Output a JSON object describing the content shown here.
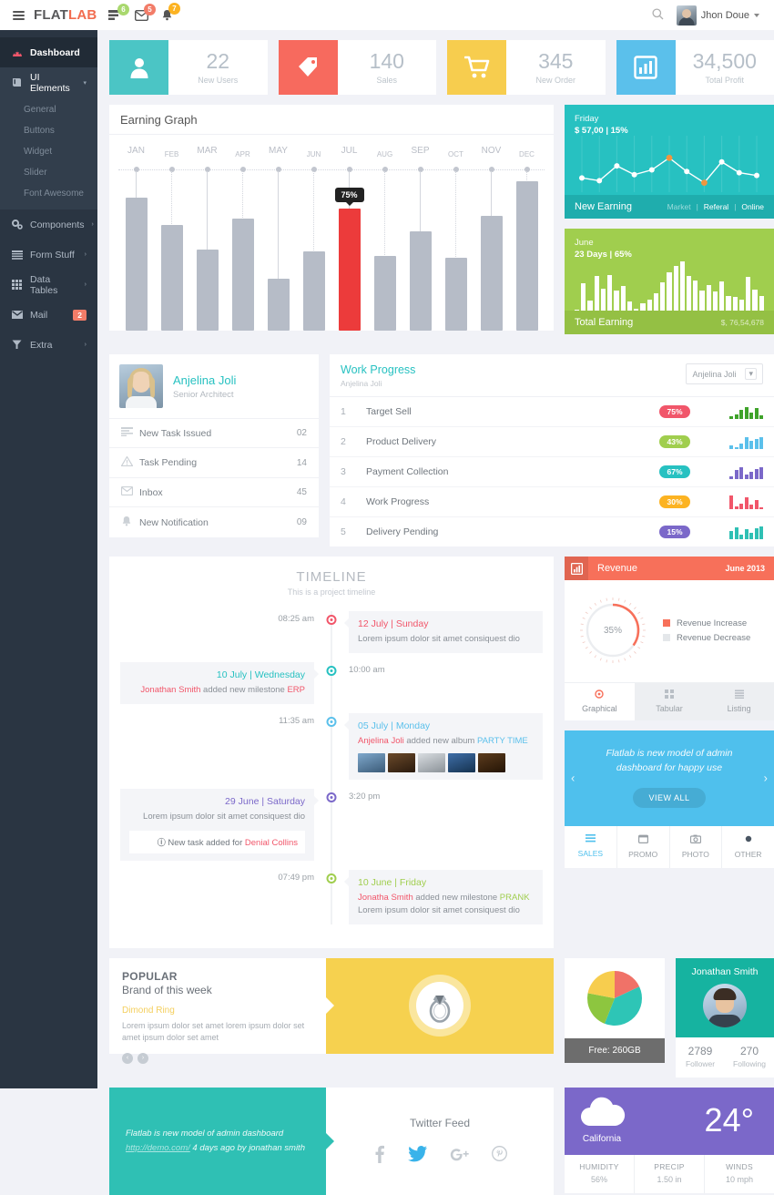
{
  "header": {
    "logo_flat": "FLAT",
    "logo_lab": "LAB",
    "icons": [
      {
        "name": "tasks-icon",
        "badge": "6",
        "color": "green"
      },
      {
        "name": "envelope-icon",
        "badge": "5",
        "color": "red"
      },
      {
        "name": "bell-icon",
        "badge": "7",
        "color": "yellow"
      }
    ],
    "search_label": "search-icon",
    "user_name": "Jhon Doue"
  },
  "sidebar": {
    "items": [
      {
        "label": "Dashboard",
        "icon": "dashboard-icon",
        "state": "active"
      },
      {
        "label": "UI Elements",
        "icon": "book-icon",
        "state": "open",
        "arrow": "▾"
      },
      {
        "label": "Components",
        "icon": "cogs-icon",
        "arrow": "›"
      },
      {
        "label": "Form Stuff",
        "icon": "form-icon",
        "arrow": "›"
      },
      {
        "label": "Data Tables",
        "icon": "table-icon",
        "arrow": "›"
      },
      {
        "label": "Mail",
        "icon": "mail-icon",
        "badge": "2"
      },
      {
        "label": "Extra",
        "icon": "filter-icon",
        "arrow": "›"
      }
    ],
    "submenu": [
      "General",
      "Buttons",
      "Widget",
      "Slider",
      "Font Awesome"
    ]
  },
  "stats": [
    {
      "icon": "user-icon",
      "value": "22",
      "label": "New Users",
      "color": "#4bc5c5"
    },
    {
      "icon": "tag-icon",
      "value": "140",
      "label": "Sales",
      "color": "#f76a5e"
    },
    {
      "icon": "cart-icon",
      "value": "345",
      "label": "New Order",
      "color": "#f7cd4e"
    },
    {
      "icon": "bar-chart-icon",
      "value": "34,500",
      "label": "Total Profit",
      "color": "#5bc0eb"
    }
  ],
  "earning_graph": {
    "title": "Earning Graph"
  },
  "chart_data": [
    {
      "type": "bar",
      "title": "Earning Graph",
      "categories": [
        "JAN",
        "FEB",
        "MAR",
        "APR",
        "MAY",
        "JUN",
        "JUL",
        "AUG",
        "SEP",
        "OCT",
        "NOV",
        "DEC"
      ],
      "values": [
        82,
        65,
        50,
        69,
        32,
        49,
        75,
        46,
        61,
        45,
        71,
        92
      ],
      "highlight_index": 6,
      "highlight_label": "75%",
      "highlight_color": "#ec3b3b",
      "bar_color": "#b6bcc7",
      "ylim": [
        0,
        100
      ],
      "xlabel": "",
      "ylabel": ""
    },
    {
      "type": "line",
      "title": "New Earning",
      "day": "Friday",
      "value": "$ 57,00 | 15%",
      "legend": [
        "Market",
        "Referal",
        "Online"
      ],
      "values": [
        22,
        15,
        52,
        30,
        42,
        72,
        38,
        10,
        62,
        35,
        28
      ],
      "ylim": [
        0,
        100
      ],
      "point_color": "#ffffff",
      "highlight_color": "#f0963f"
    },
    {
      "type": "bar",
      "title": "Total Earning",
      "month": "June",
      "subtitle": "23 Days | 65%",
      "total": "$, 76,54,678",
      "values": [
        0,
        55,
        20,
        70,
        45,
        72,
        40,
        50,
        18,
        3,
        14,
        22,
        36,
        58,
        78,
        90,
        100,
        70,
        62,
        40,
        52,
        38,
        60,
        30,
        28,
        22,
        68,
        42,
        30
      ],
      "ylim": [
        0,
        100
      ]
    },
    {
      "type": "pie",
      "title": "Revenue",
      "labels": [
        "Revenue Increase",
        "Revenue Decrease"
      ],
      "values": [
        35,
        65
      ],
      "center_label": "35%",
      "colors": [
        "#f7705a",
        "#eceef1"
      ]
    },
    {
      "type": "pie",
      "title": "Free: 260GB",
      "labels": [
        "Segment A",
        "Segment B",
        "Segment C",
        "Segment D"
      ],
      "values": [
        18,
        38,
        22,
        22
      ],
      "colors": [
        "#f07268",
        "#2ec5b6",
        "#8dc63f",
        "#f7cd4e"
      ]
    }
  ],
  "new_earning": {
    "day": "Friday",
    "value": "$ 57,00 | 15%",
    "title": "New Earning",
    "links": [
      "Market",
      "Referal",
      "Online"
    ]
  },
  "total_earning": {
    "month": "June",
    "sub": "23 Days | 65%",
    "title": "Total Earning",
    "amount": "$, 76,54,678"
  },
  "profile": {
    "name": "Anjelina Joli",
    "role": "Senior Architect",
    "rows": [
      {
        "icon": "task-list-icon",
        "label": "New Task Issued",
        "value": "02"
      },
      {
        "icon": "warning-icon",
        "label": "Task Pending",
        "value": "14"
      },
      {
        "icon": "envelope-icon",
        "label": "Inbox",
        "value": "45"
      },
      {
        "icon": "bell-icon",
        "label": "New Notification",
        "value": "09"
      }
    ]
  },
  "work_progress": {
    "title": "Work Progress",
    "subtitle": "Anjelina Joli",
    "select_value": "Anjelina Joli",
    "rows": [
      {
        "n": "1",
        "task": "Target Sell",
        "pct": "75%",
        "color": "#f1566a",
        "spark": "#3fa32a",
        "bars": [
          3,
          5,
          10,
          13,
          7,
          12,
          4
        ]
      },
      {
        "n": "2",
        "task": "Product Delivery",
        "pct": "43%",
        "color": "#a0ce4e",
        "spark": "#5bc0eb",
        "bars": [
          4,
          2,
          6,
          13,
          9,
          11,
          13
        ]
      },
      {
        "n": "3",
        "task": "Payment Collection",
        "pct": "67%",
        "color": "#27c1c1",
        "spark": "#7b68c9",
        "bars": [
          3,
          10,
          13,
          5,
          8,
          11,
          13
        ]
      },
      {
        "n": "4",
        "task": "Work Progress",
        "pct": "30%",
        "color": "#fcb322",
        "spark": "#f1566a",
        "bars": [
          15,
          3,
          6,
          13,
          5,
          10,
          2
        ]
      },
      {
        "n": "5",
        "task": "Delivery Pending",
        "pct": "15%",
        "color": "#7b68c9",
        "spark": "#2fc0b4",
        "bars": [
          9,
          13,
          5,
          11,
          7,
          12,
          14
        ]
      }
    ]
  },
  "timeline": {
    "title": "TIMELINE",
    "subtitle": "This is a project timeline",
    "items": [
      {
        "side": "right",
        "time": "08:25 am",
        "color": "#f1566a",
        "date": "12 July | Sunday",
        "date_color": "#f1566a",
        "text": "Lorem ipsum dolor sit amet consiquest dio"
      },
      {
        "side": "left",
        "time": "10:00 am",
        "color": "#27c1c1",
        "date": "10 July | Wednesday",
        "date_color": "#27c1c1",
        "text_html": "Jonathan Smith added new milestone ERP",
        "actor": "Jonathan Smith",
        "mid": " added new milestone ",
        "tag": "ERP",
        "actor_color": "#f1566a",
        "tag_color": "#f1566a"
      },
      {
        "side": "right",
        "time": "11:35 am",
        "color": "#5bc0eb",
        "date": "05 July | Monday",
        "date_color": "#5bc0eb",
        "actor": "Anjelina Joli",
        "mid": " added new album ",
        "tag": "PARTY TIME",
        "actor_color": "#f1566a",
        "tag_color": "#5bc0eb",
        "thumbs": 5
      },
      {
        "side": "left",
        "time": "3:20 pm",
        "color": "#7b68c9",
        "date": "29 June | Saturday",
        "date_color": "#7b68c9",
        "text": "Lorem ipsum dolor sit amet consiquest dio",
        "note_prefix": "New task added for ",
        "note_link": "Denial Collins",
        "note_color": "#f1566a"
      },
      {
        "side": "right",
        "time": "07:49 pm",
        "color": "#a0ce4e",
        "date": "10 June | Friday",
        "date_color": "#a0ce4e",
        "actor": "Jonatha Smith",
        "mid": " added new milestone ",
        "tag": "PRANK",
        "tail": " Lorem ipsum dolor sit amet consiquest dio",
        "actor_color": "#f1566a",
        "tag_color": "#a0ce4e"
      }
    ]
  },
  "revenue": {
    "title": "Revenue",
    "icon": "bar-chart-icon",
    "date": "June 2013",
    "percent": "35%",
    "legend": [
      {
        "label": "Revenue Increase",
        "color": "#f7705a"
      },
      {
        "label": "Revenue Decrease",
        "color": "#e4e7ea"
      }
    ],
    "tabs": [
      {
        "label": "Graphical",
        "icon": "graphical-icon",
        "active": true
      },
      {
        "label": "Tabular",
        "icon": "tabular-icon",
        "active": false
      },
      {
        "label": "Listing",
        "icon": "listing-icon",
        "active": false
      }
    ]
  },
  "carousel": {
    "text": "Flatlab is new model of admin dashboard for happy use",
    "button": "VIEW ALL",
    "prev": "‹",
    "next": "›",
    "tabs": [
      {
        "label": "SALES",
        "icon": "list-icon",
        "active": true
      },
      {
        "label": "PROMO",
        "icon": "calendar-icon",
        "active": false
      },
      {
        "label": "PHOTO",
        "icon": "camera-icon",
        "active": false
      },
      {
        "label": "OTHER",
        "icon": "dot-icon",
        "active": false
      }
    ]
  },
  "popular": {
    "title": "POPULAR",
    "subtitle": "Brand of this week",
    "brand": "Dimond Ring",
    "desc": "Lorem ipsum dolor set amet lorem ipsum dolor set amet ipsum dolor set amet",
    "prev": "‹",
    "next": "›",
    "image_name": "diamond-ring-image"
  },
  "storage": {
    "free_label": "Free: 260GB"
  },
  "social": {
    "name": "Jonathan Smith",
    "stats": [
      {
        "value": "2789",
        "label": "Follower"
      },
      {
        "value": "270",
        "label": "Following"
      }
    ]
  },
  "twitter": {
    "quote": "Flatlab is new model of admin dashboard",
    "link": "http://demo.com/",
    "meta": " 4 days ago by jonathan smith",
    "title": "Twitter Feed",
    "icons": [
      "facebook-icon",
      "twitter-icon",
      "google-plus-icon",
      "pinterest-icon"
    ]
  },
  "weather": {
    "city": "California",
    "temp": "24°",
    "icon": "cloud-icon",
    "cells": [
      {
        "key": "HUMIDITY",
        "value": "56%"
      },
      {
        "key": "PRECIP",
        "value": "1.50 in"
      },
      {
        "key": "WINDS",
        "value": "10 mph"
      }
    ]
  }
}
